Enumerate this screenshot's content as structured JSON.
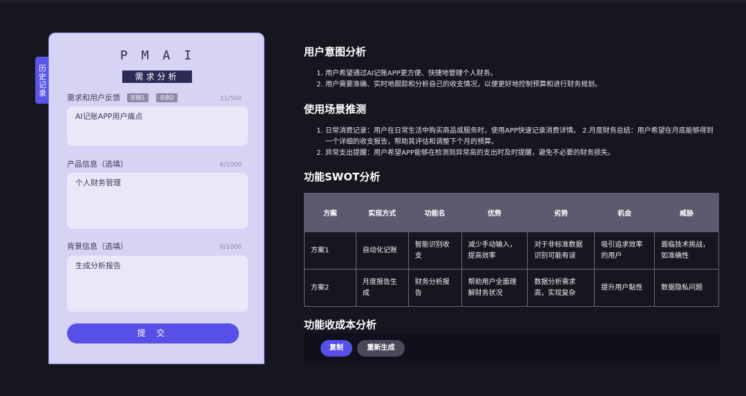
{
  "history_tab": "历史记录",
  "form": {
    "logo": "PMAI",
    "section_title": "需求分析",
    "fields": [
      {
        "label": "需求和用户反馈",
        "chips": [
          "示例1",
          "示例2"
        ],
        "counter": "11/500",
        "value": "AI记账APP用户痛点"
      },
      {
        "label": "产品信息（选填）",
        "counter": "6/1000",
        "value": "个人财务管理"
      },
      {
        "label": "背景信息（选填）",
        "counter": "6/1000",
        "value": "生成分析报告"
      }
    ],
    "submit_label": "提 交"
  },
  "content": {
    "intent_title": "用户意图分析",
    "intent_items": [
      "用户希望通过AI记账APP更方便、快捷地管理个人财务。",
      "用户需要准确、实时地跟踪和分析自己的收支情况，以便更好地控制预算和进行财务规划。"
    ],
    "scene_title": "使用场景推测",
    "scene_items": [
      "日常消费记录：用户在日常生活中购买商品或服务时，使用APP快速记录消费详情。 2.月度财务总结：用户希望在月底能够得到一个详细的收支报告，帮助其评估和调整下个月的预算。",
      "异常支出提醒：用户希望APP能够在检测到异常高的支出时及时提醒，避免不必要的财务损失。"
    ],
    "swot_title": "功能SWOT分析",
    "swot_headers": [
      "方案",
      "实现方式",
      "功能名",
      "优势",
      "劣势",
      "机会",
      "威胁"
    ],
    "swot_rows": [
      [
        "方案1",
        "自动化记账",
        "智能识别收支",
        "减少手动输入，提高效率",
        "对于非标准数据识别可能有误",
        "吸引追求效率的用户",
        "面临技术挑战，如准确性"
      ],
      [
        "方案2",
        "月度报告生成",
        "财务分析报告",
        "帮助用户全面理解财务状况",
        "数据分析需求高，实现复杂",
        "提升用户黏性",
        "数据隐私问题"
      ]
    ],
    "cost_title": "功能收成本分析",
    "copy_label": "复制",
    "regen_label": "重新生成"
  }
}
